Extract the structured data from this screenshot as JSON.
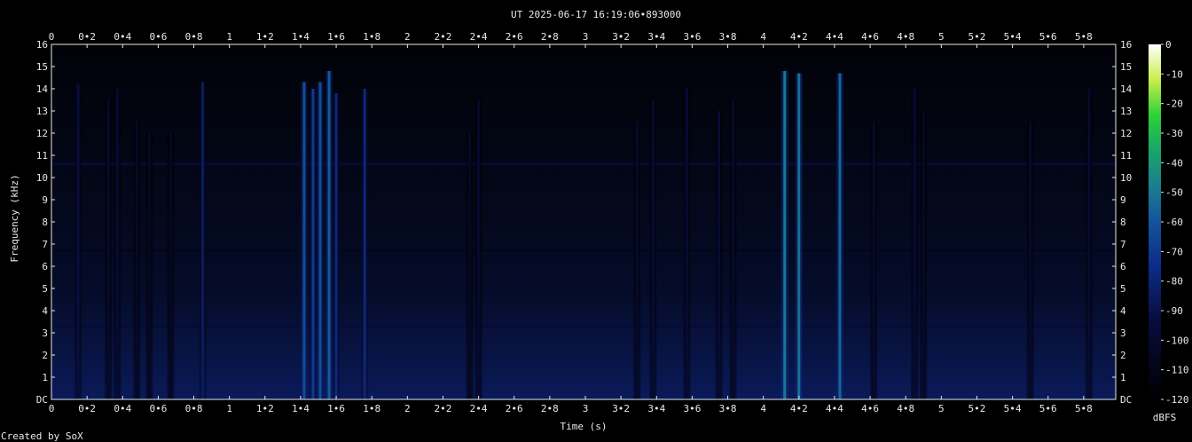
{
  "chart_data": {
    "type": "heatmap",
    "title": "UT 2025-06-17 16:19:06•893000",
    "xlabel": "Time (s)",
    "ylabel": "Frequency (kHz)",
    "xlim": [
      0,
      5.98
    ],
    "ylim": [
      0,
      16
    ],
    "x_ticks": [
      "0",
      "0•2",
      "0•4",
      "0•6",
      "0•8",
      "1",
      "1•2",
      "1•4",
      "1•6",
      "1•8",
      "2",
      "2•2",
      "2•4",
      "2•6",
      "2•8",
      "3",
      "3•2",
      "3•4",
      "3•6",
      "3•8",
      "4",
      "4•2",
      "4•4",
      "4•6",
      "4•8",
      "5",
      "5•2",
      "5•4",
      "5•6",
      "5•8"
    ],
    "y_ticks": [
      "DC",
      "1",
      "2",
      "3",
      "4",
      "5",
      "6",
      "7",
      "8",
      "9",
      "10",
      "11",
      "12",
      "13",
      "14",
      "15",
      "16"
    ],
    "colorbar": {
      "label": "dBFS",
      "ticks": [
        "0",
        "-10",
        "-20",
        "-30",
        "-40",
        "-50",
        "-60",
        "-70",
        "-80",
        "-90",
        "-100",
        "-110",
        "-120"
      ],
      "range": [
        -120,
        0
      ]
    },
    "tones": [
      {
        "freq_khz": 10.6,
        "level_dbfs": -95
      },
      {
        "freq_khz": 3.3,
        "level_dbfs": -95
      },
      {
        "freq_khz": 6.7,
        "level_dbfs": -108
      }
    ],
    "transients": [
      {
        "t": 0.15,
        "level_dbfs": -93,
        "max_freq_khz": 14.2
      },
      {
        "t": 0.32,
        "level_dbfs": -100,
        "max_freq_khz": 13.5
      },
      {
        "t": 0.37,
        "level_dbfs": -97,
        "max_freq_khz": 14.0
      },
      {
        "t": 0.48,
        "level_dbfs": -102,
        "max_freq_khz": 12.5
      },
      {
        "t": 0.55,
        "level_dbfs": -104,
        "max_freq_khz": 12.0
      },
      {
        "t": 0.67,
        "level_dbfs": -104,
        "max_freq_khz": 12.0
      },
      {
        "t": 0.85,
        "level_dbfs": -85,
        "max_freq_khz": 14.3
      },
      {
        "t": 1.42,
        "level_dbfs": -62,
        "max_freq_khz": 14.3
      },
      {
        "t": 1.47,
        "level_dbfs": -70,
        "max_freq_khz": 14.0
      },
      {
        "t": 1.51,
        "level_dbfs": -62,
        "max_freq_khz": 14.3
      },
      {
        "t": 1.56,
        "level_dbfs": -58,
        "max_freq_khz": 14.8
      },
      {
        "t": 1.6,
        "level_dbfs": -78,
        "max_freq_khz": 13.8
      },
      {
        "t": 1.76,
        "level_dbfs": -78,
        "max_freq_khz": 14.0
      },
      {
        "t": 2.35,
        "level_dbfs": -104,
        "max_freq_khz": 12.0
      },
      {
        "t": 2.4,
        "level_dbfs": -100,
        "max_freq_khz": 13.5
      },
      {
        "t": 3.29,
        "level_dbfs": -100,
        "max_freq_khz": 12.5
      },
      {
        "t": 3.38,
        "level_dbfs": -97,
        "max_freq_khz": 13.5
      },
      {
        "t": 3.57,
        "level_dbfs": -97,
        "max_freq_khz": 14.0
      },
      {
        "t": 3.75,
        "level_dbfs": -98,
        "max_freq_khz": 13.0
      },
      {
        "t": 3.83,
        "level_dbfs": -100,
        "max_freq_khz": 13.5
      },
      {
        "t": 4.12,
        "level_dbfs": -50,
        "max_freq_khz": 14.8
      },
      {
        "t": 4.2,
        "level_dbfs": -52,
        "max_freq_khz": 14.7
      },
      {
        "t": 4.43,
        "level_dbfs": -55,
        "max_freq_khz": 14.7
      },
      {
        "t": 4.62,
        "level_dbfs": -100,
        "max_freq_khz": 12.5
      },
      {
        "t": 4.85,
        "level_dbfs": -97,
        "max_freq_khz": 14.0
      },
      {
        "t": 4.9,
        "level_dbfs": -102,
        "max_freq_khz": 13.0
      },
      {
        "t": 5.5,
        "level_dbfs": -100,
        "max_freq_khz": 12.5
      },
      {
        "t": 5.83,
        "level_dbfs": -98,
        "max_freq_khz": 14.0
      }
    ]
  },
  "footer": {
    "credit": "Created by SoX"
  }
}
